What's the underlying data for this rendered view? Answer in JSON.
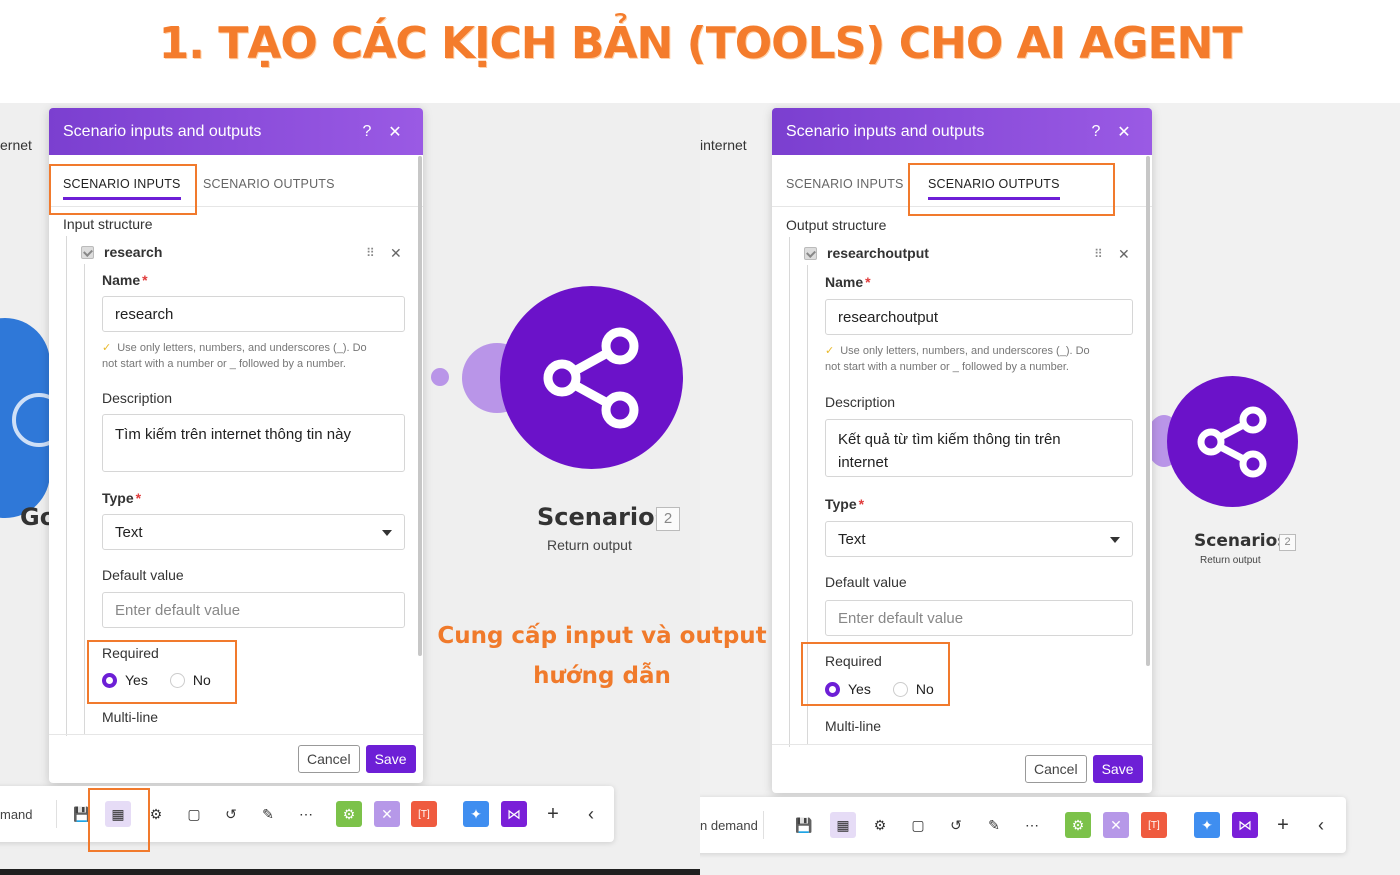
{
  "headline": "1. TẠO CÁC KỊCH BẢN (TOOLS) CHO AI AGENT",
  "callout": {
    "line1": "Cung cấp input và output",
    "line2": "hướng dẫn"
  },
  "left": {
    "bg_top_text": "ernet",
    "bg_module_partial": "Go",
    "dialog": {
      "title": "Scenario inputs and outputs",
      "help": "?",
      "close": "✕",
      "tab_inputs": "SCENARIO INPUTS",
      "tab_outputs": "SCENARIO OUTPUTS",
      "structure_label": "Input structure",
      "item_name": "research",
      "name_label": "Name",
      "name_value": "research",
      "hint_line1": "Use only letters, numbers, and underscores (_). Do",
      "hint_line2": "not start with a number or _ followed by a number.",
      "description_label": "Description",
      "description_value": "Tìm kiếm trên internet thông tin này",
      "type_label": "Type",
      "type_value": "Text",
      "default_label": "Default value",
      "default_placeholder": "Enter default value",
      "required_label": "Required",
      "yes": "Yes",
      "no": "No",
      "multiline_label": "Multi-line",
      "cancel": "Cancel",
      "save": "Save"
    },
    "module": {
      "name": "Scenarios",
      "badge": "2",
      "sub": "Return output"
    },
    "toolbar": {
      "left_text": "mand"
    }
  },
  "right": {
    "bg_top_text": "internet",
    "dialog": {
      "title": "Scenario inputs and outputs",
      "help": "?",
      "close": "✕",
      "tab_inputs": "SCENARIO INPUTS",
      "tab_outputs": "SCENARIO OUTPUTS",
      "structure_label": "Output structure",
      "item_name": "researchoutput",
      "name_label": "Name",
      "name_value": "researchoutput",
      "hint_line1": "Use only letters, numbers, and underscores (_). Do",
      "hint_line2": "not start with a number or _ followed by a number.",
      "description_label": "Description",
      "description_line1": "Kết quả từ tìm kiếm thông tin trên",
      "description_line2": "internet",
      "type_label": "Type",
      "type_value": "Text",
      "default_label": "Default value",
      "default_placeholder": "Enter default value",
      "required_label": "Required",
      "yes": "Yes",
      "no": "No",
      "multiline_label": "Multi-line",
      "cancel": "Cancel",
      "save": "Save"
    },
    "module": {
      "name": "Scenarios",
      "badge": "2",
      "sub": "Return output"
    },
    "toolbar": {
      "left_text": "n demand"
    }
  },
  "icons": {
    "save": "floppy-icon",
    "io": "scenario-io-icon",
    "settings": "gear-icon",
    "notes": "note-icon",
    "undo": "undo-icon",
    "magic": "magic-wand-icon",
    "more": "more-icon",
    "green": "flow-control-icon",
    "tools": "tools-icon",
    "text": "text-parser-icon",
    "ai": "ai-sparkle-icon",
    "share": "share-icon",
    "add": "plus-icon",
    "collapse": "chevron-left-icon"
  },
  "colors": {
    "accent": "#6d1fd6",
    "highlight": "#f17a2d",
    "headline": "#f47c2c"
  }
}
